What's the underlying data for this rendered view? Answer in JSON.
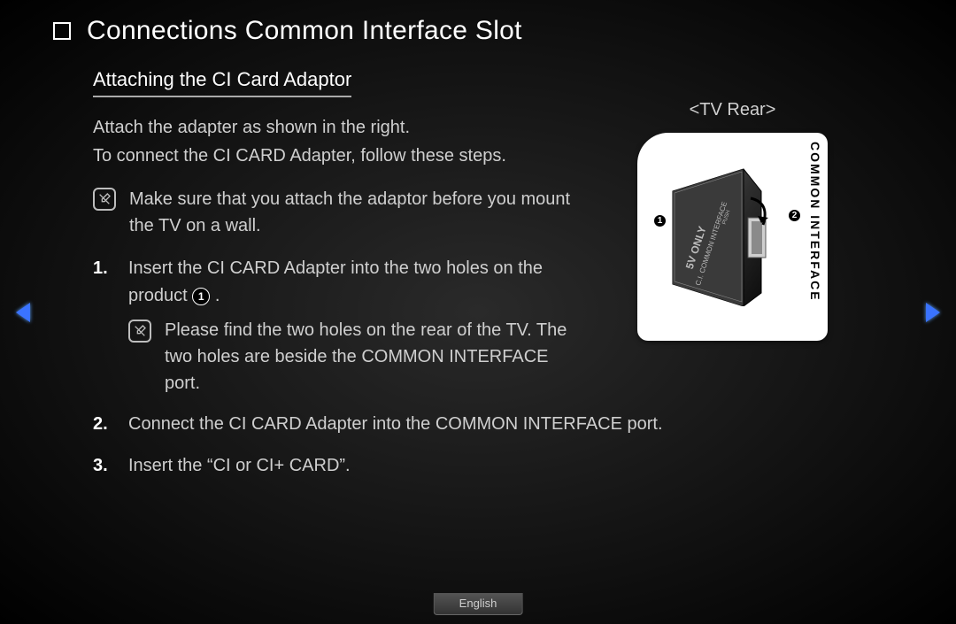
{
  "title": "Connections Common Interface Slot",
  "subtitle": "Attaching the CI Card Adaptor",
  "intro_line1": "Attach the adapter as shown in the right.",
  "intro_line2": "To connect the CI CARD Adapter, follow these steps.",
  "top_note": "Make sure that you attach the adaptor before you mount the TV on a wall.",
  "steps": {
    "s1": {
      "num": "1.",
      "text_a": "Insert the CI CARD Adapter into the two holes on the product ",
      "marker": "1",
      "text_b": ".",
      "subnote": "Please find the two holes on the rear of the TV. The two holes are beside the COMMON INTERFACE port."
    },
    "s2": {
      "num": "2.",
      "text": "Connect the CI CARD Adapter into the COMMON INTERFACE port."
    },
    "s3": {
      "num": "3.",
      "text": "Insert the “CI or CI+ CARD”."
    }
  },
  "figure": {
    "caption": "<TV Rear>",
    "side_label": "COMMON INTERFACE",
    "marker1": "1",
    "marker2": "2"
  },
  "footer_language": "English"
}
